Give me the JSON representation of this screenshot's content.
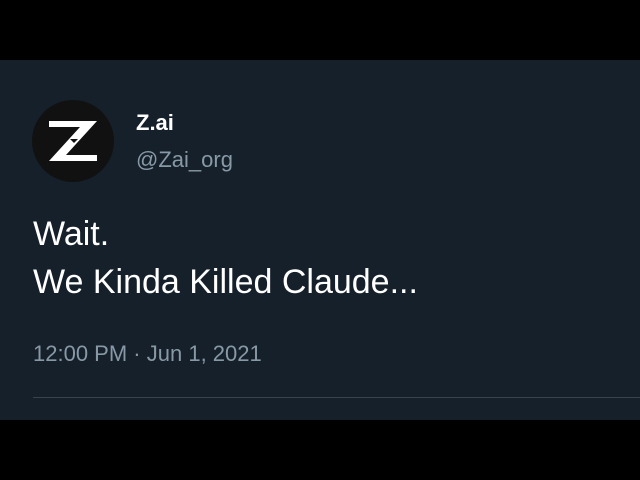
{
  "tweet": {
    "author": {
      "display_name": "Z.ai",
      "handle": "@Zai_org",
      "avatar_icon": "z-logo-icon",
      "avatar_letter": "Z"
    },
    "text_lines": [
      "Wait.",
      "We Kinda Killed Claude..."
    ],
    "time": "12:00 PM",
    "separator": "·",
    "date": "Jun 1, 2021"
  },
  "colors": {
    "outer_background": "#000000",
    "card_background": "#15202b",
    "primary_text": "#ffffff",
    "secondary_text": "#8899a6",
    "divider": "#38444d",
    "avatar_background": "#111111"
  }
}
